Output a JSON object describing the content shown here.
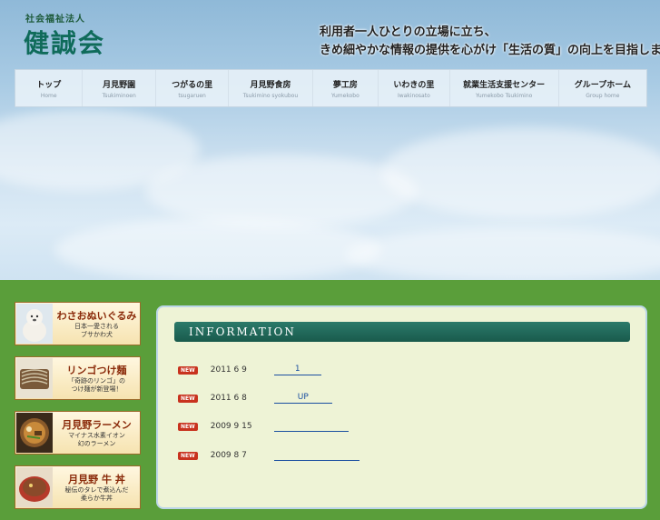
{
  "header": {
    "org_type": "社会福祉法人",
    "org_name": "健誠会",
    "tagline_1": "利用者一人ひとりの立場に立ち、",
    "tagline_2": "きめ細やかな情報の提供を心がけ「生活の質」の向上を目指します。"
  },
  "nav": {
    "items": [
      {
        "label": "トップ",
        "sub": "Home"
      },
      {
        "label": "月見野園",
        "sub": "Tsukiminoen"
      },
      {
        "label": "つがるの里",
        "sub": "tsugaruen"
      },
      {
        "label": "月見野食房",
        "sub": "Tsukimino syokubou"
      },
      {
        "label": "夢工房",
        "sub": "Yumekobo"
      },
      {
        "label": "いわきの里",
        "sub": "Iwakinosato"
      },
      {
        "label": "就業生活支援センター",
        "sub": "Yumekobo Tsukimino"
      },
      {
        "label": "グループホーム",
        "sub": "Group home"
      }
    ]
  },
  "banners": [
    {
      "title": "わさおぬいぐるみ",
      "sub": "日本一愛される\nブサかわ犬",
      "icon": "dog-plush-image"
    },
    {
      "title": "リンゴつけ麺",
      "sub": "「奇跡のリンゴ」の\nつけ麺が新登場！",
      "icon": "noodles-image"
    },
    {
      "title": "月見野ラーメン",
      "sub": "マイナス水素イオン\n幻のラーメン",
      "icon": "ramen-image"
    },
    {
      "title": "月見野 牛 丼",
      "sub": "秘伝のタレで煮込んだ\n柔らか牛丼",
      "icon": "gyudon-image"
    }
  ],
  "info": {
    "heading": "INFORMATION",
    "badge": "NEW",
    "items": [
      {
        "date": "2011  6  9",
        "link": "1"
      },
      {
        "date": "2011  6  8",
        "link": "UP"
      },
      {
        "date": "2009  9  15",
        "link": ""
      },
      {
        "date": "2009  8  7",
        "link": ""
      }
    ]
  },
  "colors": {
    "accent_green": "#195a4c",
    "new_badge": "#c8321e",
    "page_green": "#5a9e3a"
  }
}
